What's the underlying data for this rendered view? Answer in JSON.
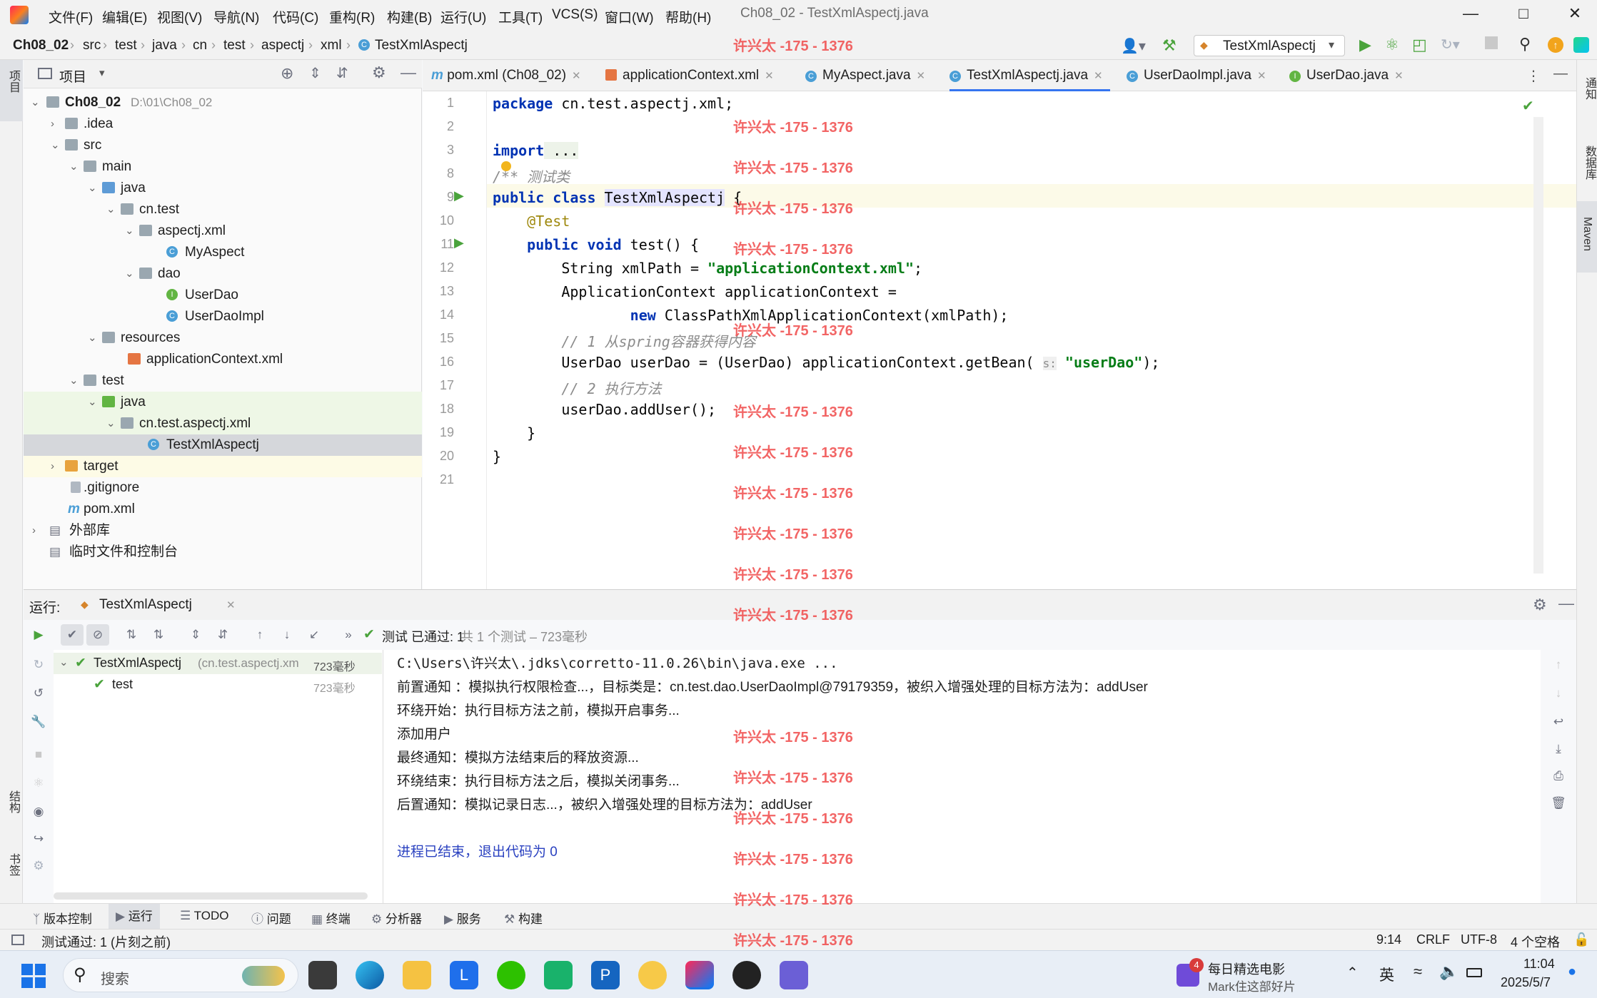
{
  "window": {
    "title": "Ch08_02 - TestXmlAspectj.java",
    "menu": [
      "文件(F)",
      "编辑(E)",
      "视图(V)",
      "导航(N)",
      "代码(C)",
      "重构(R)",
      "构建(B)",
      "运行(U)",
      "工具(T)",
      "VCS(S)",
      "窗口(W)",
      "帮助(H)"
    ]
  },
  "breadcrumb": [
    "Ch08_02",
    "src",
    "test",
    "java",
    "cn",
    "test",
    "aspectj",
    "xml",
    "TestXmlAspectj"
  ],
  "run_config": "TestXmlAspectj",
  "left_strip": {
    "project": "项目",
    "structure": "结构",
    "bookmarks": "书签"
  },
  "right_strip": {
    "notifications": "通知",
    "database": "数据库",
    "maven": "Maven"
  },
  "project_panel": {
    "title": "项目",
    "tree": [
      {
        "label": "Ch08_02",
        "extra": "D:\\01\\Ch08_02",
        "bold": true
      },
      {
        "label": ".idea"
      },
      {
        "label": "src"
      },
      {
        "label": "main"
      },
      {
        "label": "java"
      },
      {
        "label": "cn.test"
      },
      {
        "label": "aspectj.xml"
      },
      {
        "label": "MyAspect"
      },
      {
        "label": "dao"
      },
      {
        "label": "UserDao"
      },
      {
        "label": "UserDaoImpl"
      },
      {
        "label": "resources"
      },
      {
        "label": "applicationContext.xml"
      },
      {
        "label": "test"
      },
      {
        "label": "java"
      },
      {
        "label": "cn.test.aspectj.xml"
      },
      {
        "label": "TestXmlAspectj"
      },
      {
        "label": "target"
      },
      {
        "label": ".gitignore"
      },
      {
        "label": "pom.xml"
      },
      {
        "label": "外部库"
      },
      {
        "label": "临时文件和控制台"
      }
    ]
  },
  "editor_tabs": [
    {
      "label": "pom.xml (Ch08_02)"
    },
    {
      "label": "applicationContext.xml"
    },
    {
      "label": "MyAspect.java"
    },
    {
      "label": "TestXmlAspectj.java",
      "active": true
    },
    {
      "label": "UserDaoImpl.java"
    },
    {
      "label": "UserDao.java"
    }
  ],
  "code": {
    "line_numbers": [
      "1",
      "2",
      "3",
      "8",
      "9",
      "10",
      "11",
      "12",
      "13",
      "14",
      "15",
      "16",
      "17",
      "18",
      "19",
      "20",
      "21"
    ],
    "l1_kw": "package",
    "l1_rest": " cn.test.aspectj.xml;",
    "l3_kw": "import",
    "l3_rest": " ...",
    "l8": "/** 测试类",
    "l9_kw": "public class",
    "l9_name": "TestXmlAspectj",
    "l9_rest": " {",
    "l10": "@Test",
    "l11_kw": "public void",
    "l11_rest": " test() {",
    "l12_a": "String xmlPath = ",
    "l12_str": "\"applicationContext.xml\"",
    "l12_b": ";",
    "l13": "ApplicationContext applicationContext =",
    "l14_kw": "new",
    "l14_rest": " ClassPathXmlApplicationContext(xmlPath);",
    "l15": "// 1 从spring容器获得内容",
    "l16_a": "UserDao userDao = (UserDao) applicationContext.getBean( ",
    "l16_hint": "s:",
    "l16_str": " \"userDao\"",
    "l16_b": ");",
    "l17": "// 2 执行方法",
    "l18": "userDao.addUser();",
    "l19": "}",
    "l20": "}"
  },
  "watermark": "许兴太 -175 - 1376",
  "run_panel": {
    "label": "运行:",
    "tab": "TestXmlAspectj",
    "status": "测试 已通过: 1",
    "status_detail": "共 1 个测试 – 723毫秒",
    "tree": [
      {
        "label": "TestXmlAspectj",
        "extra": "(cn.test.aspectj.xm",
        "time": "723毫秒"
      },
      {
        "label": "test",
        "time": "723毫秒"
      }
    ],
    "console": [
      "C:\\Users\\许兴太\\.jdks\\corretto-11.0.26\\bin\\java.exe ...",
      "前置通知 ：模拟执行权限检查...，目标类是：cn.test.dao.UserDaoImpl@79179359，被织入增强处理的目标方法为：addUser",
      "环绕开始：执行目标方法之前，模拟开启事务...",
      "添加用户",
      "最终通知：模拟方法结束后的释放资源...",
      "环绕结束：执行目标方法之后，模拟关闭事务...",
      "后置通知：模拟记录日志...，被织入增强处理的目标方法为：addUser",
      "",
      "进程已结束，退出代码为 0"
    ]
  },
  "tool_tabs": [
    "版本控制",
    "运行",
    "TODO",
    "问题",
    "终端",
    "分析器",
    "服务",
    "构建"
  ],
  "status_bar": {
    "message": "测试通过: 1 (片刻之前)",
    "position": "9:14",
    "line_sep": "CRLF",
    "encoding": "UTF-8",
    "indent": "4 个空格"
  },
  "taskbar": {
    "search": "搜索",
    "notify_title": "每日精选电影",
    "notify_sub": "Mark住这部好片",
    "badge": "4",
    "lang": "英",
    "time": "11:04",
    "date": "2025/5/7"
  }
}
